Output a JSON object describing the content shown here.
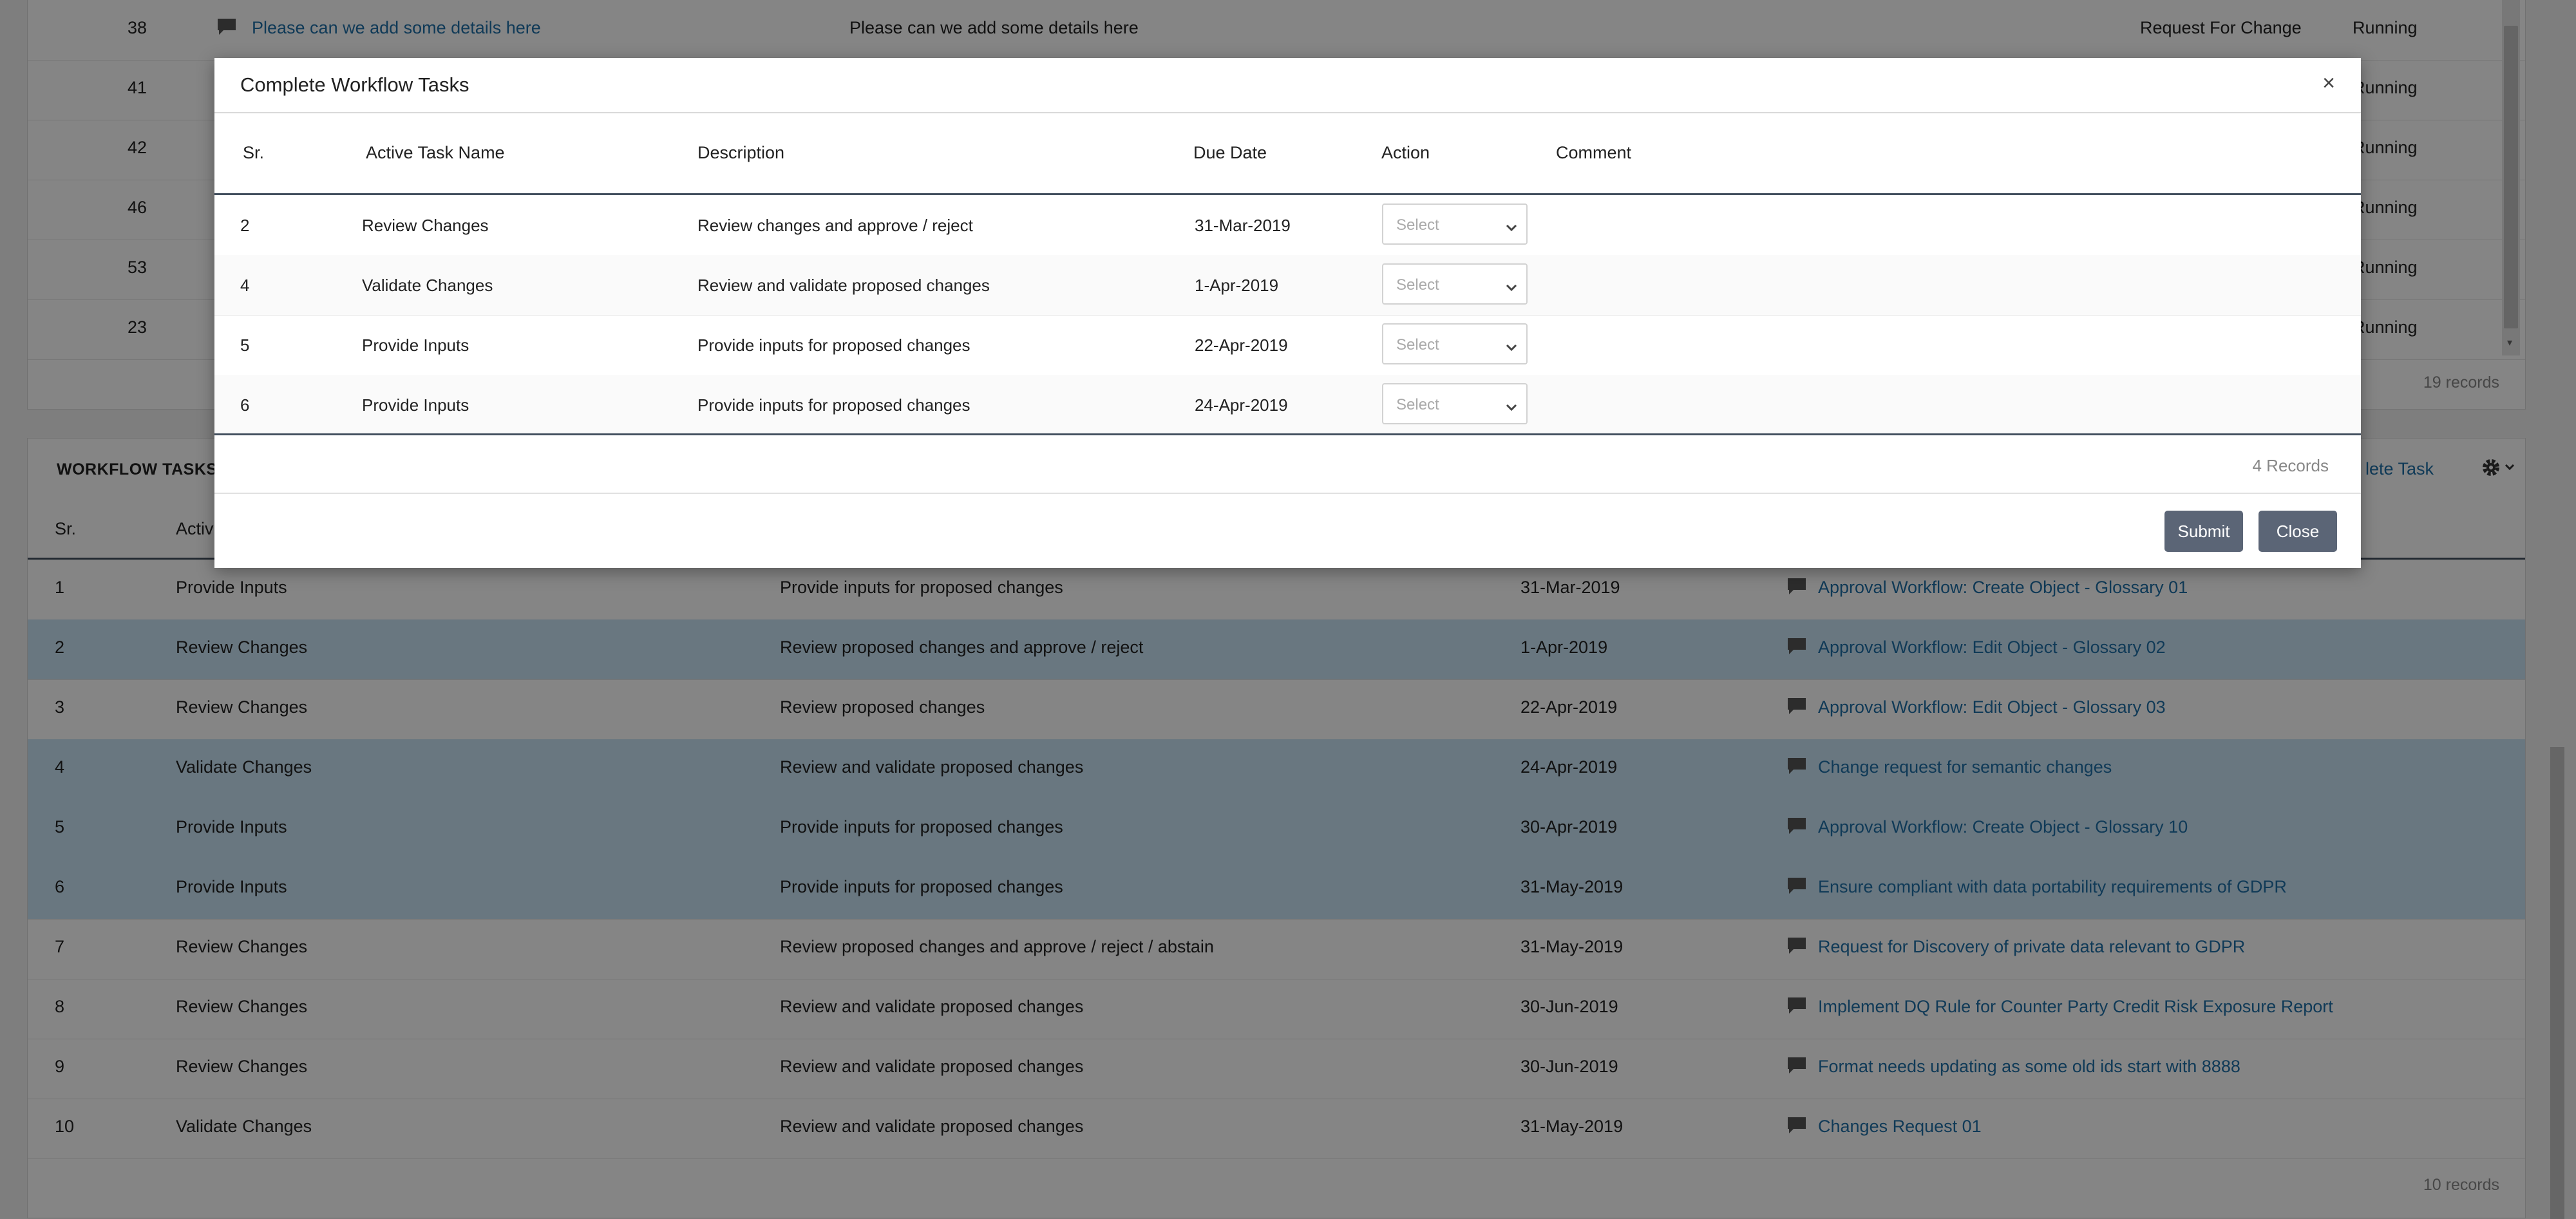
{
  "top_table": {
    "rows": [
      {
        "id": "38",
        "link": "Please can we add some details here",
        "description": "Please can we add some details here",
        "type": "Request For Change",
        "status": "Running"
      },
      {
        "id": "41",
        "status": "Running"
      },
      {
        "id": "42",
        "status": "Running"
      },
      {
        "id": "46",
        "status": "Running"
      },
      {
        "id": "53",
        "status": "Running"
      },
      {
        "id": "23",
        "status": "Running"
      }
    ],
    "records": "19 records"
  },
  "workflow_tasks": {
    "title": "WORKFLOW TASKS",
    "complete_task_label": "lete Task",
    "header_sr": "Sr.",
    "header_name": "Activ",
    "rows": [
      {
        "sr": "1",
        "name": "Provide Inputs",
        "description": "Provide inputs for proposed changes",
        "due": "31-Mar-2019",
        "link": "Approval Workflow: Create Object - Glossary 01"
      },
      {
        "sr": "2",
        "name": "Review Changes",
        "description": "Review proposed changes and approve / reject",
        "due": "1-Apr-2019",
        "link": "Approval Workflow: Edit Object - Glossary 02"
      },
      {
        "sr": "3",
        "name": "Review Changes",
        "description": "Review proposed changes",
        "due": "22-Apr-2019",
        "link": "Approval Workflow: Edit Object - Glossary 03"
      },
      {
        "sr": "4",
        "name": "Validate Changes",
        "description": "Review and validate proposed changes",
        "due": "24-Apr-2019",
        "link": "Change request for semantic changes"
      },
      {
        "sr": "5",
        "name": "Provide Inputs",
        "description": "Provide inputs for proposed changes",
        "due": "30-Apr-2019",
        "link": "Approval Workflow: Create Object - Glossary 10"
      },
      {
        "sr": "6",
        "name": "Provide Inputs",
        "description": "Provide inputs for proposed changes",
        "due": "31-May-2019",
        "link": "Ensure compliant with data portability requirements of GDPR"
      },
      {
        "sr": "7",
        "name": "Review Changes",
        "description": "Review proposed changes and approve / reject / abstain",
        "due": "31-May-2019",
        "link": "Request for Discovery of private data relevant to GDPR"
      },
      {
        "sr": "8",
        "name": "Review Changes",
        "description": "Review and validate proposed changes",
        "due": "30-Jun-2019",
        "link": "Implement DQ Rule for Counter Party Credit Risk Exposure Report"
      },
      {
        "sr": "9",
        "name": "Review Changes",
        "description": "Review and validate proposed changes",
        "due": "30-Jun-2019",
        "link": "Format needs updating as some old ids start with 8888"
      },
      {
        "sr": "10",
        "name": "Validate Changes",
        "description": "Review and validate proposed changes",
        "due": "31-May-2019",
        "link": "Changes Request 01"
      }
    ],
    "records": "10 records"
  },
  "modal": {
    "title": "Complete Workflow Tasks",
    "close_symbol": "×",
    "headers": {
      "sr": "Sr.",
      "name": "Active Task Name",
      "description": "Description",
      "due": "Due Date",
      "action": "Action",
      "comment": "Comment"
    },
    "rows": [
      {
        "sr": "2",
        "name": "Review Changes",
        "description": "Review changes and approve / reject",
        "due": "31-Mar-2019",
        "action": "Select"
      },
      {
        "sr": "4",
        "name": "Validate Changes",
        "description": "Review and validate proposed changes",
        "due": "1-Apr-2019",
        "action": "Select"
      },
      {
        "sr": "5",
        "name": "Provide Inputs",
        "description": "Provide inputs for proposed changes",
        "due": "22-Apr-2019",
        "action": "Select"
      },
      {
        "sr": "6",
        "name": "Provide Inputs",
        "description": "Provide inputs for proposed changes",
        "due": "24-Apr-2019",
        "action": "Select"
      }
    ],
    "records": "4 Records",
    "submit_label": "Submit",
    "close_label": "Close"
  },
  "colors": {
    "accent": "#1f6fa8",
    "header_rule": "#43505f",
    "button": "#5b6576",
    "row_highlight": "#c9e4f5"
  },
  "icons": [
    "comment-icon",
    "gear-icon",
    "chevron-down-icon",
    "close-icon"
  ]
}
